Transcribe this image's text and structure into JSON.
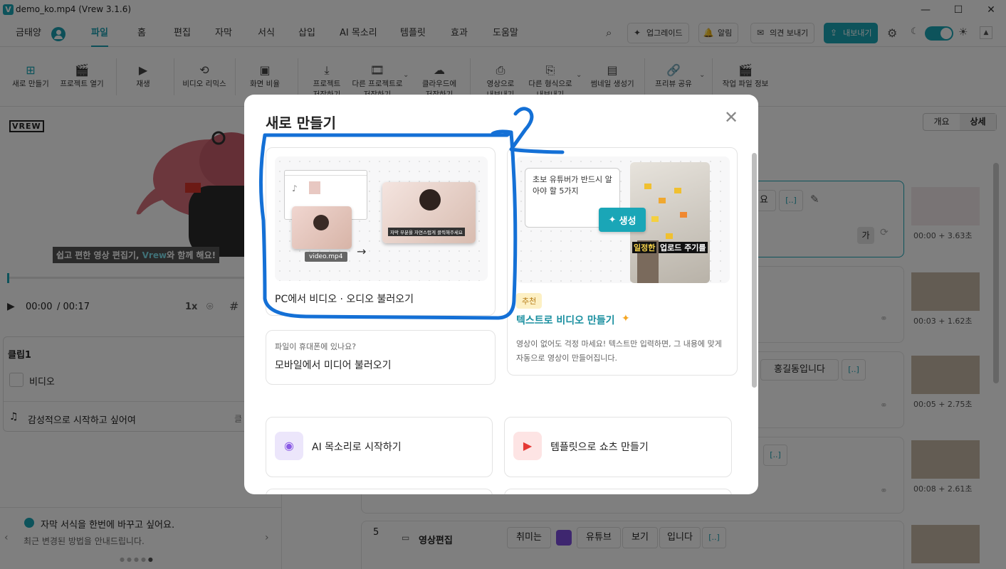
{
  "window": {
    "title": "demo_ko.mp4 (Vrew 3.1.6)",
    "logo": "V",
    "minimize": "—",
    "maximize": "☐",
    "close": "✕"
  },
  "user": {
    "name": "금태양"
  },
  "menu": [
    "파일",
    "홈",
    "편집",
    "자막",
    "서식",
    "삽입",
    "AI 목소리",
    "템플릿",
    "효과",
    "도움말"
  ],
  "menu_active_index": 0,
  "topright": {
    "upgrade": "업그레이드",
    "notice": "알림",
    "feedback": "의견 보내기",
    "export": "내보내기"
  },
  "toolbar": [
    {
      "icon": "plus-square-icon",
      "label1": "새로 만들기",
      "label2": ""
    },
    {
      "icon": "clapperboard-icon",
      "label1": "프로젝트 열기",
      "label2": ""
    },
    {
      "icon": "play-icon",
      "label1": "재생",
      "label2": ""
    },
    {
      "icon": "remix-icon",
      "label1": "비디오 리믹스",
      "label2": ""
    },
    {
      "icon": "aspect-ratio-icon",
      "label1": "화면 비율",
      "label2": ""
    },
    {
      "icon": "download-icon",
      "label1": "프로젝트",
      "label2": "저장하기"
    },
    {
      "icon": "save-as-icon",
      "label1": "다른 프로젝트로",
      "label2": "저장하기"
    },
    {
      "icon": "cloud-icon",
      "label1": "클라우드에",
      "label2": "저장하기"
    },
    {
      "icon": "video-export-icon",
      "label1": "영상으로",
      "label2": "내보내기"
    },
    {
      "icon": "format-export-icon",
      "label1": "다른 형식으로",
      "label2": "내보내기"
    },
    {
      "icon": "thumbnail-icon",
      "label1": "썸네일 생성기",
      "label2": ""
    },
    {
      "icon": "link-icon",
      "label1": "프리뷰 공유",
      "label2": ""
    },
    {
      "icon": "file-info-icon",
      "label1": "작업 파일 정보",
      "label2": ""
    }
  ],
  "preview": {
    "logo": "VREW",
    "caption_pre": "쉽고 편한 영상 편집기, ",
    "caption_brand": "Vrew",
    "caption_post": "와 함께 해요!",
    "time_current": "00:00",
    "time_total": "/ 00:17",
    "speed": "1x"
  },
  "clip_panel": {
    "title": "클립1",
    "video_label": "비디오",
    "music_label": "감성적으로 시작하고 싶어여",
    "music_right": "클"
  },
  "tips": {
    "title": "자막 서식을 한번에 바꾸고 싶어요.",
    "sub": "최근 변경된 방법을 안내드립니다."
  },
  "view_toggle": {
    "overview": "개요",
    "detail": "상세"
  },
  "clips": [
    {
      "time": "00:00 + 3.63초",
      "word": "요",
      "hangul": "가"
    },
    {
      "time": "00:03 + 1.62초"
    },
    {
      "time": "00:05 + 2.75초",
      "word": "홍길동입니다"
    },
    {
      "time": "00:08 + 2.61초"
    }
  ],
  "clip5": {
    "num": "5",
    "title": "영상편집",
    "words": [
      "취미는",
      "유튜브",
      "보기",
      "입니다"
    ]
  },
  "bracket_token": "[..]",
  "modal": {
    "title": "새로 만들기",
    "close": "✕",
    "pc_card": {
      "label": "PC에서 비디오 · 오디오 불러오기",
      "filename": "video.mp4",
      "subtitle": "자막 부분을 자연스럽게 클릭해주세요"
    },
    "text_card": {
      "bubble": "초보 유튜버가 반드시 알아야 할 5가지",
      "generate": "생성",
      "overlay1": "일정한",
      "overlay2": "업로드 주기를",
      "badge": "추천",
      "title": "텍스트로 비디오 만들기",
      "desc": "영상이 없어도 걱정 마세요! 텍스트만 입력하면, 그 내용에 맞게 자동으로 영상이 만들어집니다."
    },
    "mobile_card": {
      "hint": "파일이 휴대폰에 있나요?",
      "label": "모바일에서 미디어 불러오기"
    },
    "ai_voice_card": {
      "label": "AI 목소리로 시작하기"
    },
    "template_card": {
      "label": "템플릿으로 쇼츠 만들기"
    }
  },
  "annotation": {
    "number": "2",
    "color": "#1470d6"
  }
}
